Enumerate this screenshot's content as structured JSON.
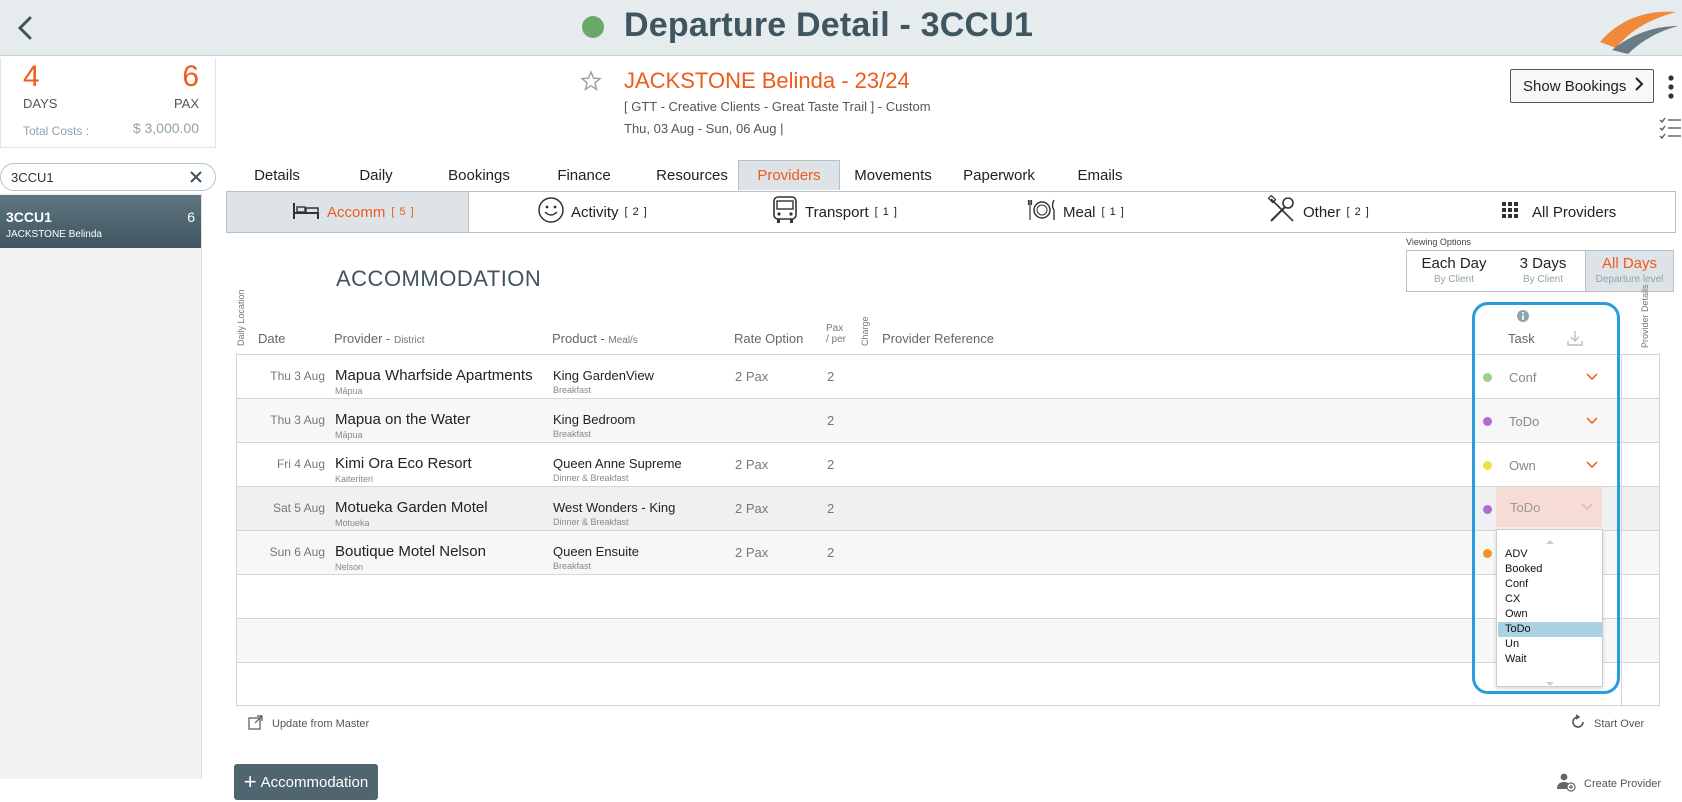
{
  "header": {
    "title": "Departure Detail - 3CCU1",
    "status_color": "#6aa86a"
  },
  "stats": {
    "days_value": "4",
    "days_label": "DAYS",
    "pax_value": "6",
    "pax_label": "PAX",
    "total_costs_label": "Total Costs :",
    "total_costs_value": "$ 3,000.00"
  },
  "search": {
    "value": "3CCU1"
  },
  "departures": [
    {
      "code": "3CCU1",
      "name": "JACKSTONE Belinda",
      "count": "6"
    }
  ],
  "trip": {
    "name": "JACKSTONE Belinda - 23/24",
    "subtitle": "[ GTT - Creative Clients - Great Taste Trail ] - Custom",
    "dates": "Thu, 03 Aug  - Sun, 06 Aug  |"
  },
  "actions": {
    "show_bookings": "Show Bookings"
  },
  "tabs": [
    "Details",
    "Daily",
    "Bookings",
    "Finance",
    "Resources",
    "Providers",
    "Movements",
    "Paperwork",
    "Emails"
  ],
  "subtabs": [
    {
      "label": "Accomm",
      "count": "[ 5 ]"
    },
    {
      "label": "Activity",
      "count": "[ 2 ]"
    },
    {
      "label": "Transport",
      "count": "[ 1 ]"
    },
    {
      "label": "Meal",
      "count": "[ 1 ]"
    },
    {
      "label": "Other",
      "count": "[ 2 ]"
    },
    {
      "label": "All Providers",
      "count": ""
    }
  ],
  "viewing_options": {
    "label": "Viewing Options",
    "options": [
      {
        "main": "Each Day",
        "sub": "By Client"
      },
      {
        "main": "3 Days",
        "sub": "By Client"
      },
      {
        "main": "All Days",
        "sub": "Departure level"
      }
    ]
  },
  "section": {
    "title": "ACCOMMODATION"
  },
  "columns": {
    "daily_location": "Daily Location",
    "date": "Date",
    "provider": "Provider",
    "district": "District",
    "product": "Product",
    "meals": "Meal/s",
    "rate_option": "Rate Option",
    "pax_per_1": "Pax",
    "pax_per_2": "/ per",
    "charge": "Charge",
    "provider_reference": "Provider Reference",
    "task": "Task",
    "provider_details": "Provider Details"
  },
  "rows": [
    {
      "date": "Thu 3 Aug",
      "provider": "Mapua Wharfside Apartments",
      "district": "Māpua",
      "product": "King GardenView",
      "meal": "Breakfast",
      "rate": "2 Pax",
      "pax": "2",
      "task": "Conf",
      "task_color": "#9ed08a"
    },
    {
      "date": "Thu 3 Aug",
      "provider": "Mapua on the Water",
      "district": "Māpua",
      "product": "King Bedroom",
      "meal": "Breakfast",
      "rate": "",
      "pax": "2",
      "task": "ToDo",
      "task_color": "#b36bd1"
    },
    {
      "date": "Fri 4 Aug",
      "provider": "Kimi Ora Eco Resort",
      "district": "Kaiteriteri",
      "product": "Queen Anne Supreme",
      "meal": "Dinner & Breakfast",
      "rate": "2 Pax",
      "pax": "2",
      "task": "Own",
      "task_color": "#f0e040"
    },
    {
      "date": "Sat 5 Aug",
      "provider": "Motueka Garden Motel",
      "district": "Motueka",
      "product": "West Wonders - King",
      "meal": "Dinner & Breakfast",
      "rate": "2 Pax",
      "pax": "2",
      "task": "ToDo",
      "task_color": "#b36bd1"
    },
    {
      "date": "Sun 6 Aug",
      "provider": "Boutique Motel Nelson",
      "district": "Nelson",
      "product": "Queen Ensuite",
      "meal": "Breakfast",
      "rate": "2 Pax",
      "pax": "2",
      "task": "",
      "task_color": "#f0942a"
    }
  ],
  "task_dropdown": {
    "options": [
      "ADV",
      "Booked",
      "Conf",
      "CX",
      "Own",
      "ToDo",
      "Un",
      "Wait"
    ],
    "selected": "ToDo"
  },
  "footer": {
    "update_from_master": "Update from Master",
    "start_over": "Start Over",
    "add_accommodation": "Accommodation",
    "create_provider": "Create Provider"
  },
  "colors": {
    "accent": "#f05a1a",
    "header_bg": "#e6ebee",
    "highlight_border": "#2b9be0",
    "dark_slate": "#3f5560"
  }
}
